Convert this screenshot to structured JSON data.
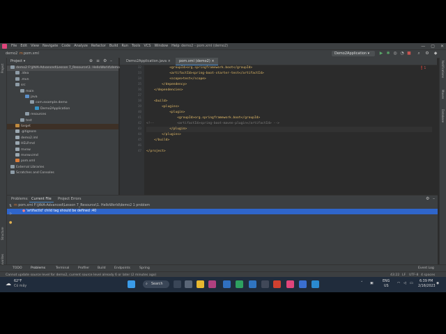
{
  "menubar": {
    "items": [
      "File",
      "Edit",
      "View",
      "Navigate",
      "Code",
      "Analyze",
      "Refactor",
      "Build",
      "Run",
      "Tools",
      "VCS",
      "Window",
      "Help"
    ],
    "title": "demo2 - pom.xml (demo2)",
    "controls": [
      "—",
      "▢",
      "✕"
    ]
  },
  "navbar": {
    "project": "demo2",
    "file": "pom.xml",
    "run_config": "Demo2Application ▾"
  },
  "left_stripe": {
    "labels": [
      "Project",
      "Structure",
      "Favorites"
    ]
  },
  "right_stripe": {
    "labels": [
      "Notifications",
      "Maven",
      "Database"
    ]
  },
  "project_panel": {
    "title": "Project ▾",
    "rows": [
      {
        "label": "demo2  F:\\JAVA-Advanced\\Lesson 7_Resource\\1. HelloWorld\\demo2",
        "indent": 0,
        "icon": "folder"
      },
      {
        "label": ".idea",
        "indent": 1,
        "icon": "folder"
      },
      {
        "label": ".mvn",
        "indent": 1,
        "icon": "folder"
      },
      {
        "label": "src",
        "indent": 1,
        "icon": "folder"
      },
      {
        "label": "main",
        "indent": 2,
        "icon": "folder"
      },
      {
        "label": "java",
        "indent": 3,
        "icon": "folder-blue"
      },
      {
        "label": "com.example.demo",
        "indent": 4,
        "icon": "package"
      },
      {
        "label": "Demo2Application",
        "indent": 5,
        "icon": "class"
      },
      {
        "label": "resources",
        "indent": 3,
        "icon": "folder"
      },
      {
        "label": "test",
        "indent": 2,
        "icon": "folder"
      },
      {
        "label": "target",
        "indent": 1,
        "icon": "folder-orange"
      },
      {
        "label": ".gitignore",
        "indent": 1,
        "icon": "file"
      },
      {
        "label": "demo2.iml",
        "indent": 1,
        "icon": "file"
      },
      {
        "label": "HELP.md",
        "indent": 1,
        "icon": "file"
      },
      {
        "label": "mvnw",
        "indent": 1,
        "icon": "file"
      },
      {
        "label": "mvnw.cmd",
        "indent": 1,
        "icon": "file"
      },
      {
        "label": "pom.xml",
        "indent": 1,
        "icon": "maven"
      },
      {
        "label": "External Libraries",
        "indent": 0,
        "icon": "lib"
      },
      {
        "label": "Scratches and Consoles",
        "indent": 0,
        "icon": "scratch"
      }
    ]
  },
  "editor": {
    "tabs": [
      "Demo2Application.java ×",
      "pom.xml (demo2) ×"
    ],
    "line_numbers": [
      "32",
      "33",
      "34",
      "35",
      "36",
      "37",
      "38",
      "39",
      "40",
      "41",
      "42",
      "43",
      "44",
      "45",
      "46",
      "47"
    ],
    "lines": [
      {
        "indent": "            ",
        "text": "<groupId>org.springframework.boot</groupId>",
        "kind": "tag"
      },
      {
        "indent": "            ",
        "text": "<artifactId>spring-boot-starter-test</artifactId>",
        "kind": "tag"
      },
      {
        "indent": "            ",
        "text": "<scope>test</scope>",
        "kind": "tag"
      },
      {
        "indent": "        ",
        "text": "</dependency>",
        "kind": "tag"
      },
      {
        "indent": "    ",
        "text": "</dependencies>",
        "kind": "tag"
      },
      {
        "indent": "",
        "text": "",
        "kind": "txt"
      },
      {
        "indent": "    ",
        "text": "<build>",
        "kind": "tag"
      },
      {
        "indent": "        ",
        "text": "<plugins>",
        "kind": "tag"
      },
      {
        "indent": "            ",
        "text": "<plugin>",
        "kind": "tag"
      },
      {
        "indent": "                ",
        "text": "<groupId>org.springframework.boot</groupId>",
        "kind": "tag"
      },
      {
        "indent": "<!--            ",
        "text": "<artifactId>spring-boot-maven-plugin</artifactId> -->",
        "kind": "cmt"
      },
      {
        "indent": "            ",
        "text": "</plugin>",
        "kind": "tag"
      },
      {
        "indent": "        ",
        "text": "</plugins>",
        "kind": "tag"
      },
      {
        "indent": "    ",
        "text": "</build>",
        "kind": "tag"
      },
      {
        "indent": "",
        "text": "",
        "kind": "txt"
      },
      {
        "indent": "",
        "text": "</project>",
        "kind": "tag"
      }
    ],
    "breadcrumb": [
      "project",
      "build",
      "plugins",
      "plugin"
    ]
  },
  "problems": {
    "tabs": [
      "Problems:",
      "Current File",
      "Project Errors"
    ],
    "file_row": "pom.xml  F:\\JAVA-Advanced\\Lesson 7_Resource\\1. HelloWorld\\demo2  1 problem",
    "error_row": "'artifactId' child tag should be defined :40"
  },
  "bottom_tools": [
    "TODO",
    "Problems",
    "Terminal",
    "Profiler",
    "Build",
    "Endpoints",
    "Spring",
    "Event Log"
  ],
  "statusbar": {
    "message": "Cannot update source level for demo2, current source level already 6 or later (2 minutes ago)",
    "position": "43:22",
    "line_sep": "LF",
    "encoding": "UTF-8",
    "indent": "4 spaces"
  },
  "taskbar": {
    "weather_temp": "62°F",
    "weather_desc": "Có mây",
    "search": "Search",
    "lang": "ENG",
    "region": "US",
    "time": "6:39 PM",
    "date": "2/16/2023"
  }
}
